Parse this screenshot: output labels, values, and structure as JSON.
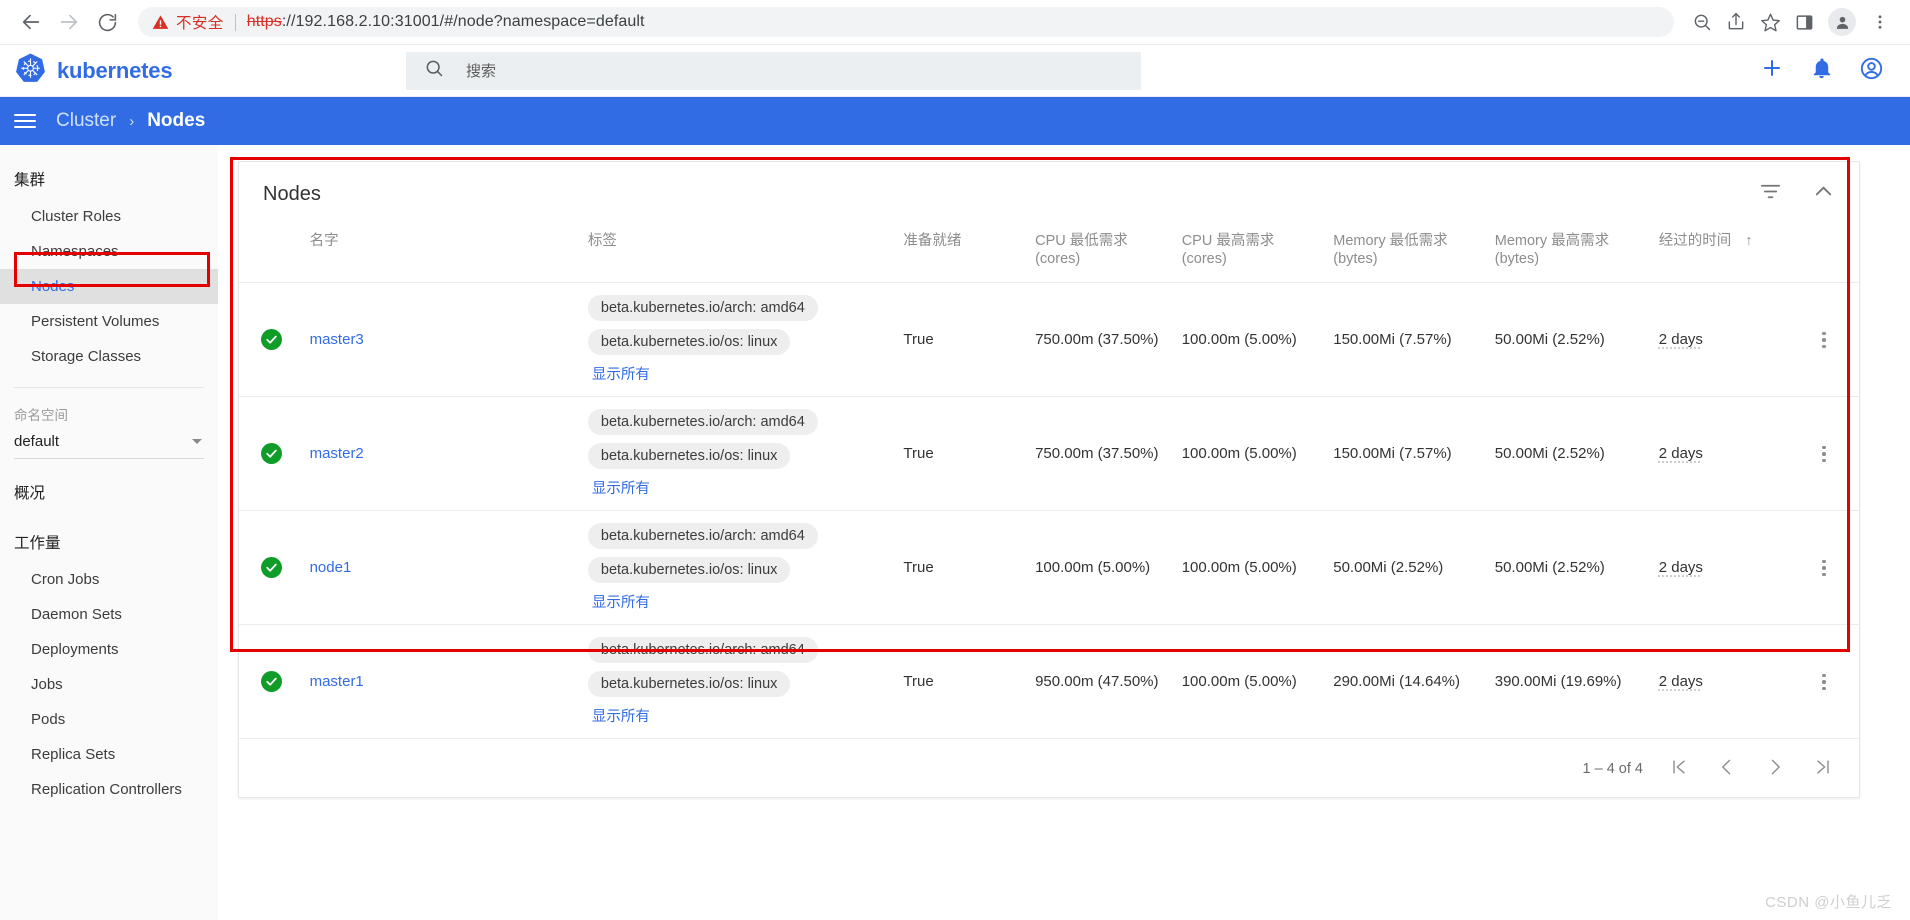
{
  "browser": {
    "back_icon": "back-arrow-icon",
    "forward_icon": "forward-arrow-icon",
    "reload_icon": "reload-icon",
    "security_warning": "不安全",
    "url_scheme": "https",
    "url_rest": "://192.168.2.10:31001/#/node?namespace=default",
    "full_url": "https://192.168.2.10:31001/#/node?namespace=default",
    "actions": [
      "zoom-out-icon",
      "share-icon",
      "bookmark-star-icon",
      "side-panel-icon",
      "profile-avatar-icon",
      "browser-menu-icon"
    ]
  },
  "header": {
    "brand": "kubernetes",
    "search_placeholder": "搜索",
    "search_value": "",
    "actions": [
      "plus-icon",
      "bell-icon",
      "account-icon"
    ],
    "accent_color": "#326ce5"
  },
  "breadcrumb": {
    "menu_icon": "hamburger-menu-icon",
    "parent": "Cluster",
    "separator": "›",
    "current": "Nodes"
  },
  "sidebar": {
    "cluster_section": "集群",
    "cluster_items": [
      {
        "label": "Cluster Roles",
        "active": false
      },
      {
        "label": "Namespaces",
        "active": false
      },
      {
        "label": "Nodes",
        "active": true
      },
      {
        "label": "Persistent Volumes",
        "active": false
      },
      {
        "label": "Storage Classes",
        "active": false
      }
    ],
    "namespace_label": "命名空间",
    "namespace_value": "default",
    "overview_section": "概况",
    "workload_section": "工作量",
    "workload_items": [
      {
        "label": "Cron Jobs"
      },
      {
        "label": "Daemon Sets"
      },
      {
        "label": "Deployments"
      },
      {
        "label": "Jobs"
      },
      {
        "label": "Pods"
      },
      {
        "label": "Replica Sets"
      },
      {
        "label": "Replication Controllers"
      }
    ]
  },
  "card": {
    "title": "Nodes",
    "filter_icon": "filter-icon",
    "collapse_icon": "chevron-up-icon"
  },
  "table": {
    "columns": [
      {
        "key": "status",
        "label": ""
      },
      {
        "key": "name",
        "label": "名字"
      },
      {
        "key": "labels",
        "label": "标签"
      },
      {
        "key": "ready",
        "label": "准备就绪"
      },
      {
        "key": "cpu_min",
        "label": "CPU 最低需求",
        "sub": "(cores)"
      },
      {
        "key": "cpu_max",
        "label": "CPU 最高需求",
        "sub": "(cores)"
      },
      {
        "key": "mem_min",
        "label": "Memory 最低需求",
        "sub": "(bytes)"
      },
      {
        "key": "mem_max",
        "label": "Memory 最高需求",
        "sub": "(bytes)"
      },
      {
        "key": "age",
        "label": "经过的时间",
        "sort": "↑"
      },
      {
        "key": "menu",
        "label": ""
      }
    ],
    "show_all_label": "显示所有",
    "status_icon": "check-circle-icon",
    "row_menu_icon": "kebab-menu-icon",
    "rows": [
      {
        "status": "ok",
        "name": "master3",
        "labels": [
          "beta.kubernetes.io/arch: amd64",
          "beta.kubernetes.io/os: linux"
        ],
        "ready": "True",
        "cpu_min": "750.00m (37.50%)",
        "cpu_max": "100.00m (5.00%)",
        "mem_min": "150.00Mi (7.57%)",
        "mem_max": "50.00Mi (2.52%)",
        "age": "2 days"
      },
      {
        "status": "ok",
        "name": "master2",
        "labels": [
          "beta.kubernetes.io/arch: amd64",
          "beta.kubernetes.io/os: linux"
        ],
        "ready": "True",
        "cpu_min": "750.00m (37.50%)",
        "cpu_max": "100.00m (5.00%)",
        "mem_min": "150.00Mi (7.57%)",
        "mem_max": "50.00Mi (2.52%)",
        "age": "2 days"
      },
      {
        "status": "ok",
        "name": "node1",
        "labels": [
          "beta.kubernetes.io/arch: amd64",
          "beta.kubernetes.io/os: linux"
        ],
        "ready": "True",
        "cpu_min": "100.00m (5.00%)",
        "cpu_max": "100.00m (5.00%)",
        "mem_min": "50.00Mi (2.52%)",
        "mem_max": "50.00Mi (2.52%)",
        "age": "2 days"
      },
      {
        "status": "ok",
        "name": "master1",
        "labels": [
          "beta.kubernetes.io/arch: amd64",
          "beta.kubernetes.io/os: linux"
        ],
        "ready": "True",
        "cpu_min": "950.00m (47.50%)",
        "cpu_max": "100.00m (5.00%)",
        "mem_min": "290.00Mi (14.64%)",
        "mem_max": "390.00Mi (19.69%)",
        "age": "2 days"
      }
    ]
  },
  "pagination": {
    "range_text": "1 – 4 of 4",
    "first_label": "|<",
    "prev_label": "‹",
    "next_label": "›",
    "last_label": ">|"
  },
  "watermark": "CSDN @小鱼儿乏"
}
